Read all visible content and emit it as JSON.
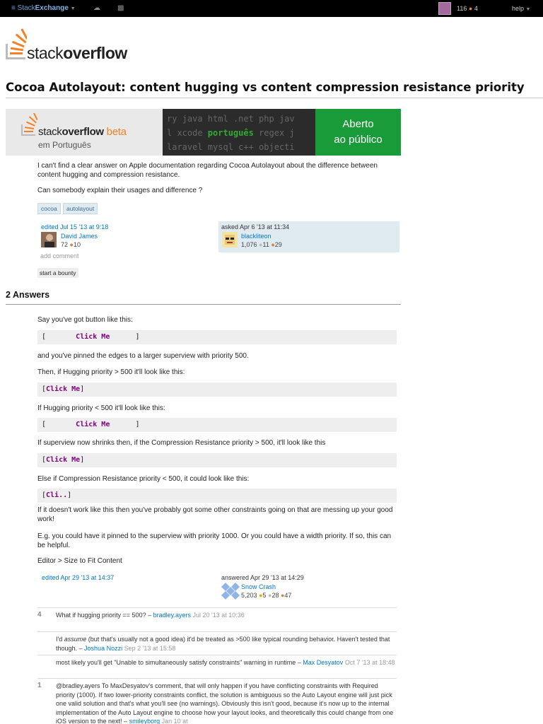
{
  "topbar": {
    "brand_light": "Stack",
    "brand_bold": "Exchange",
    "reputation": "116",
    "badges": "4",
    "help_label": "help"
  },
  "logo": {
    "light": "stack",
    "bold": "overflow"
  },
  "question": {
    "title": "Cocoa Autolayout: content hugging vs content compression resistance priority",
    "paragraph_1": "I can't find a clear answer on Apple documentation regarding Cocoa Autolayout about the difference between content hugging and compression resistance.",
    "paragraph_2": "Can somebody explain their usages and difference ?",
    "tags": [
      "cocoa",
      "autolayout"
    ],
    "edited": {
      "label": "edited Jul 15 '13 at 9:18",
      "user": "David James",
      "rep": "72",
      "bronze": "10"
    },
    "asked": {
      "label": "asked Apr 6 '13 at 11:34",
      "user": "blackliteon",
      "rep": "1,076",
      "silver": "11",
      "bronze": "29"
    },
    "add_comment": "add comment",
    "bounty": "start a bounty"
  },
  "banner": {
    "word_light": "stack",
    "word_bold": "overflow",
    "beta": "beta",
    "subtitle": "em Português",
    "code_line_1": "ry java html .net php jav",
    "code_line_2a": "l xcode ",
    "code_line_2b": "português",
    "code_line_2c": " regex j",
    "code_line_3": "laravel mysql c++ objecti",
    "cta_line_1": "Aberto",
    "cta_line_2": "ao público"
  },
  "answers_header": "2 Answers",
  "answer": {
    "intro": "Say you've got button like this:",
    "code_1_open": "[       ",
    "code_1_kw": "Click Me",
    "code_1_close": "      ]",
    "line_2": "and you've pinned the edges to a larger superview with priority 500.",
    "line_3": "Then, if Hugging priority > 500 it'll look like this:",
    "code_2_open": "[",
    "code_2_kw": "Click Me",
    "code_2_close": "]",
    "line_4": "If Hugging priority < 500 it'll look like this:",
    "code_3_open": "[       ",
    "code_3_kw": "Click Me",
    "code_3_close": "      ]",
    "line_5": "If superview now shrinks then, if the Compression Resistance priority > 500, it'll look like this",
    "code_4_open": "[",
    "code_4_kw": "Click Me",
    "code_4_close": "]",
    "line_6": "Else if Compression Resistance priority < 500, it could look like this:",
    "code_5_open": "[",
    "code_5_kw": "Cli..",
    "code_5_close": "]",
    "line_7": "If it doesn't work like this then you've probably got some other constraints going on that are messing up your good work!",
    "line_8": "E.g. you could have it pinned to the superview with priority 1000. Or you could have a width priority. If so, this can be helpful.",
    "line_9": "Editor > Size to Fit Content",
    "edited_label": "edited Apr 29 '13 at 14:37",
    "answered": {
      "label": "answered Apr 29 '13 at 14:29",
      "user": "Snow Crash",
      "rep": "5,203",
      "gold": "5",
      "silver": "28",
      "bronze": "47"
    }
  },
  "comments": [
    {
      "votes": "4",
      "text": "What if hugging priority == 500?",
      "user": "bradley.ayers",
      "date": "Jul 20 '13 at 10:36"
    },
    {
      "votes": "",
      "text_a": "I'd ",
      "text_em": "assume",
      "text_b": " (but that's usually not a good idea) it'd be treated as >500 like typical rounding behavior. Haven't tested that though.",
      "user": "Joshua Nozzi",
      "date": "Sep 2 '13 at 15:58"
    },
    {
      "votes": "",
      "text": "most likely you'll get \"Unable to simultaneously satisfy constraints\" warning in runtime",
      "user": "Max Desyatov",
      "date": "Oct 7 '13 at 18:48"
    },
    {
      "votes": "1",
      "text": "@bradley.ayers To MaxDesyatov's comment, that will only happen if you have conflicting constraints with Required priority (1000). If two lower-priority constraints conflict, the solution is ambiguous so the Auto Layout engine will just pick one valid solution and that's what you'll see (no warnings). Obviously this isn't good, because it's now up to the internal implementation of the Auto Layout engine to choose how your layout looks, and theoretically this could change from one iOS version to the next!",
      "user": "smileyborg",
      "date": "Jan 10 at"
    }
  ]
}
